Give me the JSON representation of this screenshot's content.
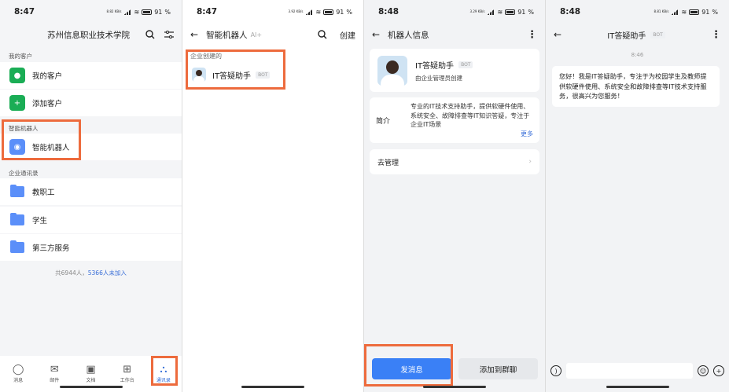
{
  "colors": {
    "accent": "#3a80f6",
    "highlight": "#ed6b3d",
    "wechat_green": "#1aad55",
    "folder_blue": "#5b8ff9"
  },
  "panel1": {
    "time": "8:47",
    "net": "8.82 KB/s",
    "battery": "91",
    "title": "苏州信息职业技术学院",
    "sections": {
      "customers": "我的客户",
      "robots": "智能机器人",
      "directory": "企业通讯录"
    },
    "rows": {
      "my_customers": "我的客户",
      "add_customer": "添加客户",
      "smart_robot": "智能机器人",
      "faculty": "教职工",
      "students": "学生",
      "third_party": "第三方服务"
    },
    "count_prefix": "共6944人，",
    "count_link": "5366人未加入",
    "tabs": [
      "消息",
      "邮件",
      "文档",
      "工作台",
      "通讯录"
    ]
  },
  "panel2": {
    "time": "8:47",
    "net": "3.92 KB/s",
    "battery": "91",
    "title": "智能机器人",
    "title_tag": "AI+",
    "create": "创建",
    "group": "企业创建的",
    "bot_name": "IT答疑助手",
    "bot_tag": "BOT"
  },
  "panel3": {
    "time": "8:48",
    "net": "3.29 KB/s",
    "battery": "91",
    "title": "机器人信息",
    "bot_name": "IT答疑助手",
    "bot_tag": "BOT",
    "creator": "由企业管理员创建",
    "intro_label": "简介",
    "intro_text": "专业的IT技术支持助手，提供软硬件使用、系统安全、故障排查等IT知识答疑，专注于企业IT场景",
    "more": "更多",
    "manage": "去管理",
    "send_button": "发消息",
    "add_group_button": "添加到群聊"
  },
  "panel4": {
    "time": "8:48",
    "net": "8.81 KB/s",
    "battery": "91",
    "title": "IT答疑助手",
    "bot_tag": "BOT",
    "msg_time": "8:46",
    "message": "您好！我是IT答疑助手，专注于为校园学生及教师提供软硬件使用、系统安全和故障排查等IT技术支持服务，很高兴为您服务！"
  }
}
